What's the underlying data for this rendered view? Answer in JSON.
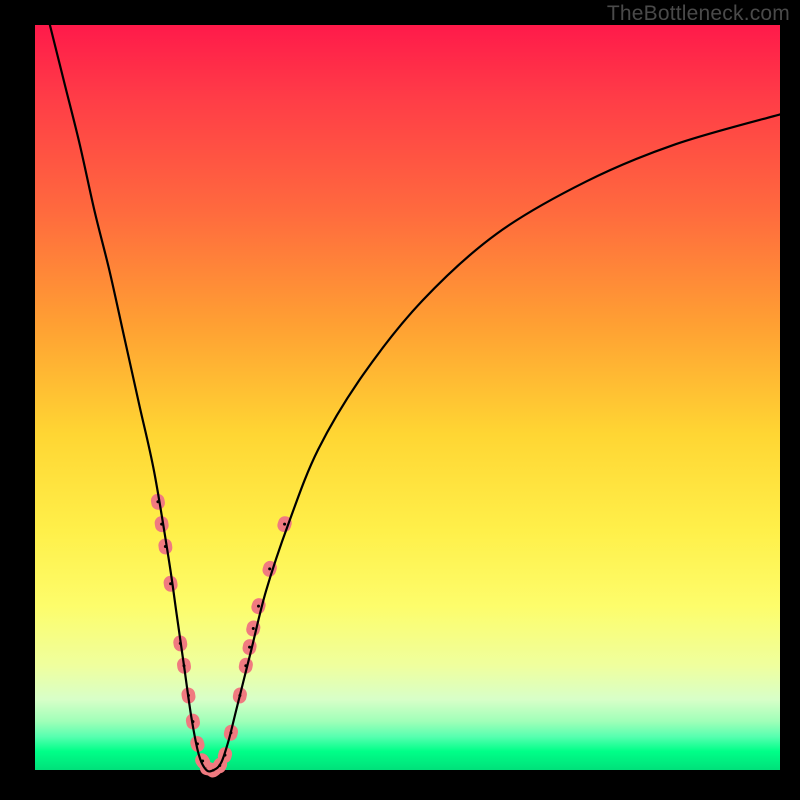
{
  "watermark": "TheBottleneck.com",
  "chart_data": {
    "type": "line",
    "title": "",
    "xlabel": "",
    "ylabel": "",
    "xlim": [
      0,
      100
    ],
    "ylim": [
      0,
      100
    ],
    "grid": false,
    "legend": false,
    "gradient_description": "vertical red-to-green (red top, green bottom) indicating bottleneck severity",
    "series": [
      {
        "name": "bottleneck-curve",
        "stroke": "#000000",
        "x": [
          2,
          4,
          6,
          8,
          10,
          12,
          14,
          16,
          18,
          19,
          20,
          21,
          22,
          23,
          24,
          25,
          26,
          27,
          29,
          31,
          34,
          38,
          44,
          52,
          62,
          74,
          86,
          100
        ],
        "y": [
          100,
          92,
          84,
          75,
          67,
          58,
          49,
          40,
          28,
          21,
          14,
          7,
          2,
          0,
          0,
          1,
          4,
          8,
          16,
          24,
          33,
          43,
          53,
          63,
          72,
          79,
          84,
          88
        ]
      }
    ],
    "beads": {
      "description": "salmon bead markers clustered near the V trough",
      "color": "#f07a80",
      "points": [
        {
          "x": 16.5,
          "y": 36
        },
        {
          "x": 17.0,
          "y": 33
        },
        {
          "x": 17.5,
          "y": 30
        },
        {
          "x": 18.2,
          "y": 25
        },
        {
          "x": 19.5,
          "y": 17
        },
        {
          "x": 20.0,
          "y": 14
        },
        {
          "x": 20.6,
          "y": 10
        },
        {
          "x": 21.2,
          "y": 6.5
        },
        {
          "x": 21.8,
          "y": 3.5
        },
        {
          "x": 22.5,
          "y": 1.2
        },
        {
          "x": 23.2,
          "y": 0.2
        },
        {
          "x": 24.0,
          "y": 0.0
        },
        {
          "x": 24.8,
          "y": 0.6
        },
        {
          "x": 25.5,
          "y": 2.0
        },
        {
          "x": 26.3,
          "y": 5.0
        },
        {
          "x": 27.5,
          "y": 10.0
        },
        {
          "x": 28.3,
          "y": 14.0
        },
        {
          "x": 28.8,
          "y": 16.5
        },
        {
          "x": 29.3,
          "y": 19.0
        },
        {
          "x": 30.0,
          "y": 22.0
        },
        {
          "x": 31.5,
          "y": 27.0
        },
        {
          "x": 33.5,
          "y": 33.0
        }
      ]
    }
  }
}
